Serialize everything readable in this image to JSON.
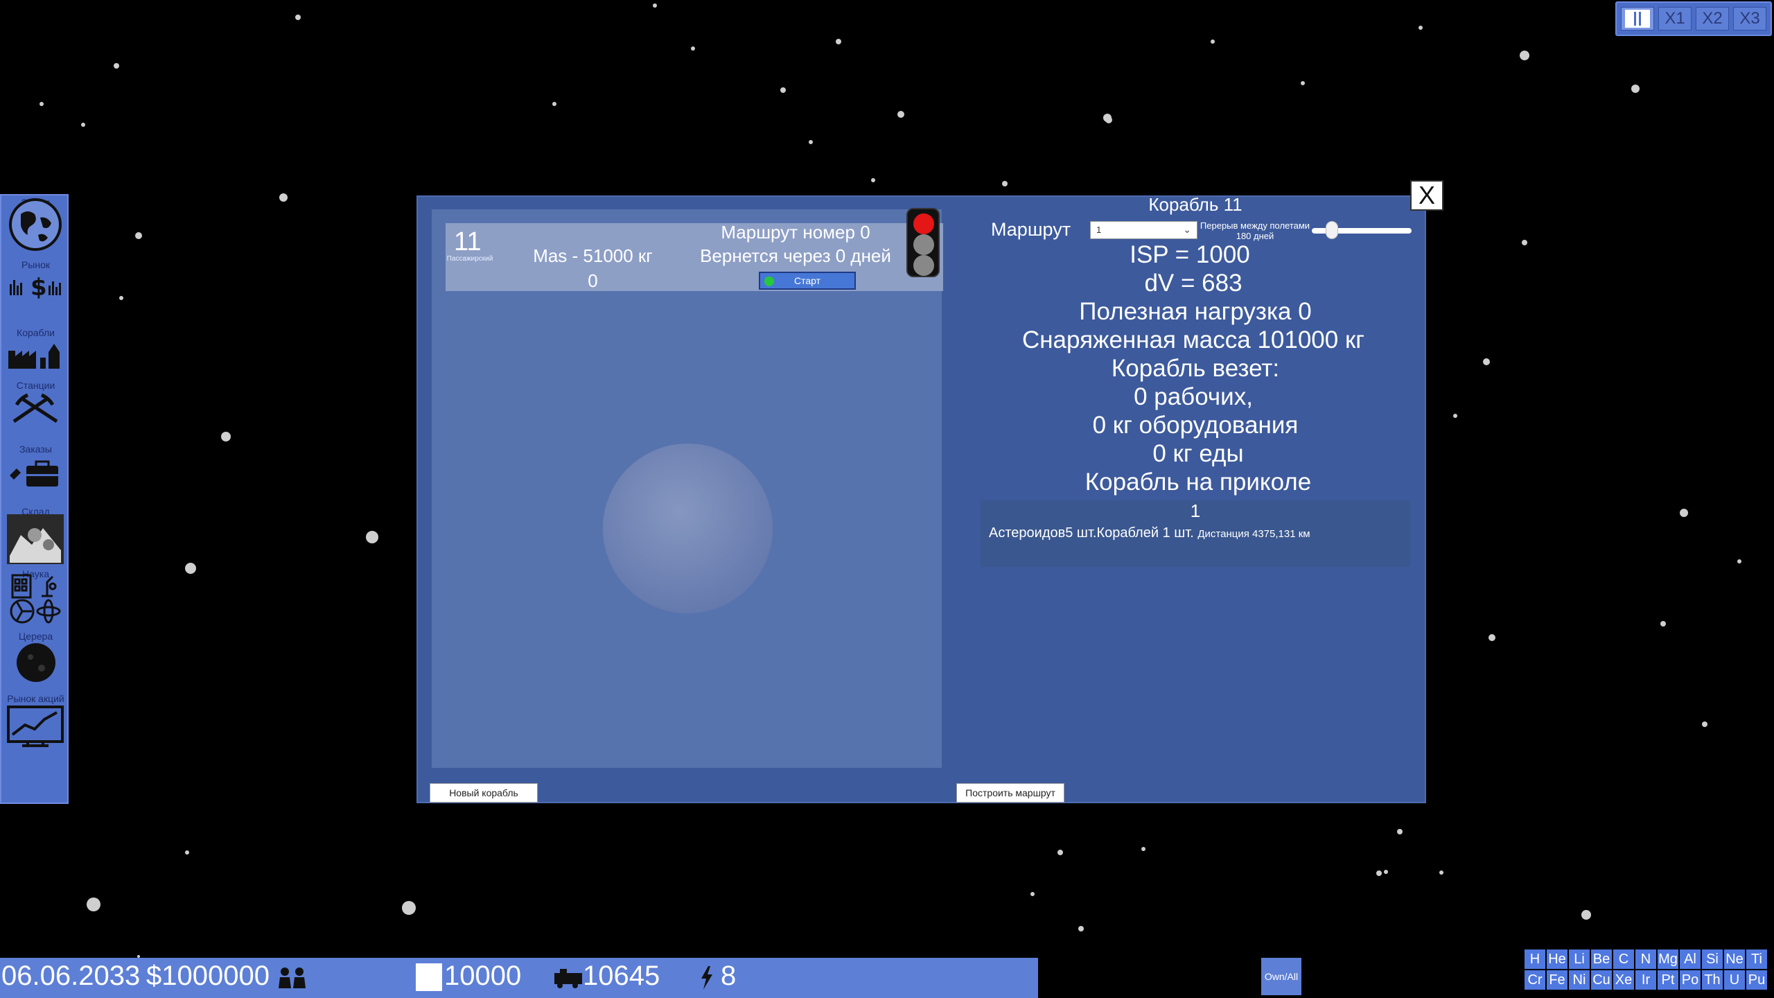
{
  "speed_controls": {
    "x1": "X1",
    "x2": "X2",
    "x3": "X3"
  },
  "sidebar": {
    "items": [
      {
        "label": "Земля",
        "icon": "globe-icon"
      },
      {
        "label": "Рынок",
        "icon": "market-icon"
      },
      {
        "label": "Корабли",
        "icon": "shipyard-icon"
      },
      {
        "label": "Станции",
        "icon": "mining-icon"
      },
      {
        "label": "Заказы",
        "icon": "briefcase-icon"
      },
      {
        "label": "Склад",
        "icon": "warehouse-icon"
      },
      {
        "label": "Наука",
        "icon": "science-icon"
      },
      {
        "label": "Церера",
        "icon": "ceres-icon"
      },
      {
        "label": "Рынок акций",
        "icon": "stock-chart-icon"
      }
    ]
  },
  "ship_card": {
    "number": "11",
    "type": "Пассажирский",
    "mass": "Mas - 51000 кг",
    "count": "0",
    "route": "Маршрут номер 0",
    "returns": "Вернется через 0 дней",
    "start_label": "Старт"
  },
  "details": {
    "title": "Корабль 11",
    "route_label": "Маршрут",
    "route_value": "1",
    "pause_label": "Перерыв между полетами",
    "pause_value": "180 дней",
    "pause_fraction": 0.16,
    "isp": "ISP = 1000",
    "dv": "dV = 683",
    "payload": "Полезная нагрузка 0",
    "dry_mass": "Снаряженная масса 101000 кг",
    "carries": "Корабль везет:",
    "workers": "0 рабочих,",
    "equipment": "0 кг оборудования",
    "food": "0 кг еды",
    "status": "Корабль на приколе"
  },
  "destination": {
    "number": "1",
    "asteroids": "Астероидов5 шт.",
    "ships": "Кораблей 1 шт.",
    "distance": "Дистанция 4375,131 км"
  },
  "buttons": {
    "new_ship": "Новый корабль",
    "build_route": "Построить маршрут",
    "close": "X",
    "own_all": "Own/All"
  },
  "status_bar": {
    "date": "06.06.2033",
    "money": "$1000000",
    "resource1": "10000",
    "resource2": "10645",
    "energy": "8"
  },
  "elements": [
    "H",
    "He",
    "Li",
    "Be",
    "C",
    "N",
    "Mg",
    "Al",
    "Si",
    "Ne",
    "Ti",
    "Cr",
    "Fe",
    "Ni",
    "Cu",
    "Xe",
    "Ir",
    "Pt",
    "Po",
    "Th",
    "U",
    "Pu"
  ],
  "colors": {
    "ui_blue": "#5d7fd6",
    "dialog_bg": "#3d5a9c",
    "traffic_red": "#e41616",
    "start_led": "#26c93a"
  }
}
